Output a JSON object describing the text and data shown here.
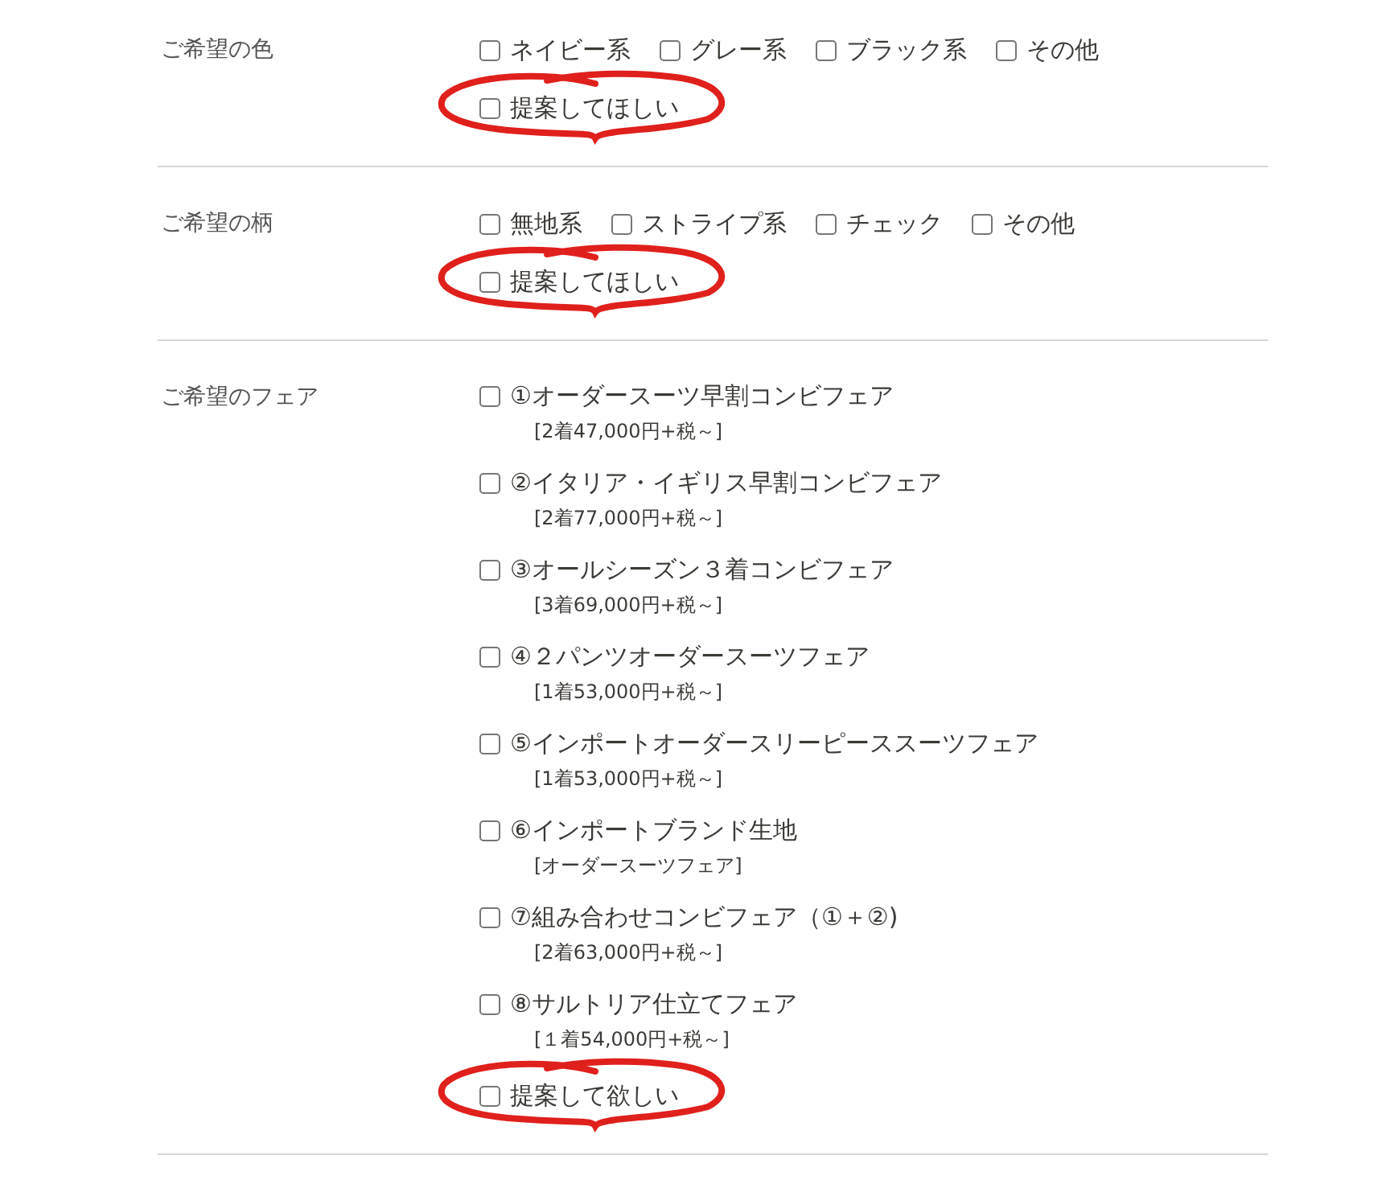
{
  "sections": [
    {
      "label": "ご希望の色",
      "options": [
        {
          "label": "ネイビー系",
          "checked": false
        },
        {
          "label": "グレー系",
          "checked": false
        },
        {
          "label": "ブラック系",
          "checked": false
        },
        {
          "label": "その他",
          "checked": false
        }
      ],
      "suggestion": {
        "label": "提案してほしい",
        "checked": false,
        "annotated": true
      }
    },
    {
      "label": "ご希望の柄",
      "options": [
        {
          "label": "無地系",
          "checked": false
        },
        {
          "label": "ストライプ系",
          "checked": false
        },
        {
          "label": "チェック",
          "checked": false
        },
        {
          "label": "その他",
          "checked": false
        }
      ],
      "suggestion": {
        "label": "提案してほしい",
        "checked": false,
        "annotated": true
      }
    },
    {
      "label": "ご希望のフェア",
      "fairs": [
        {
          "label": "①オーダースーツ早割コンビフェア",
          "note": "[2着47,000円+税～]",
          "checked": false
        },
        {
          "label": "②イタリア・イギリス早割コンビフェア",
          "note": "[2着77,000円+税～]",
          "checked": false
        },
        {
          "label": "③オールシーズン３着コンビフェア",
          "note": "[3着69,000円+税～]",
          "checked": false
        },
        {
          "label": "④２パンツオーダースーツフェア",
          "note": "[1着53,000円+税～]",
          "checked": false
        },
        {
          "label": "⑤インポートオーダースリーピーススーツフェア",
          "note": "[1着53,000円+税～]",
          "checked": false
        },
        {
          "label": "⑥インポートブランド生地",
          "note": "[オーダースーツフェア]",
          "checked": false
        },
        {
          "label": "⑦組み合わせコンビフェア（①＋②)",
          "note": "[2着63,000円+税～]",
          "checked": false
        },
        {
          "label": "⑧サルトリア仕立てフェア",
          "note": "[１着54,000円+税～]",
          "checked": false
        }
      ],
      "suggestion": {
        "label": "提案して欲しい",
        "checked": false,
        "annotated": true
      }
    }
  ]
}
